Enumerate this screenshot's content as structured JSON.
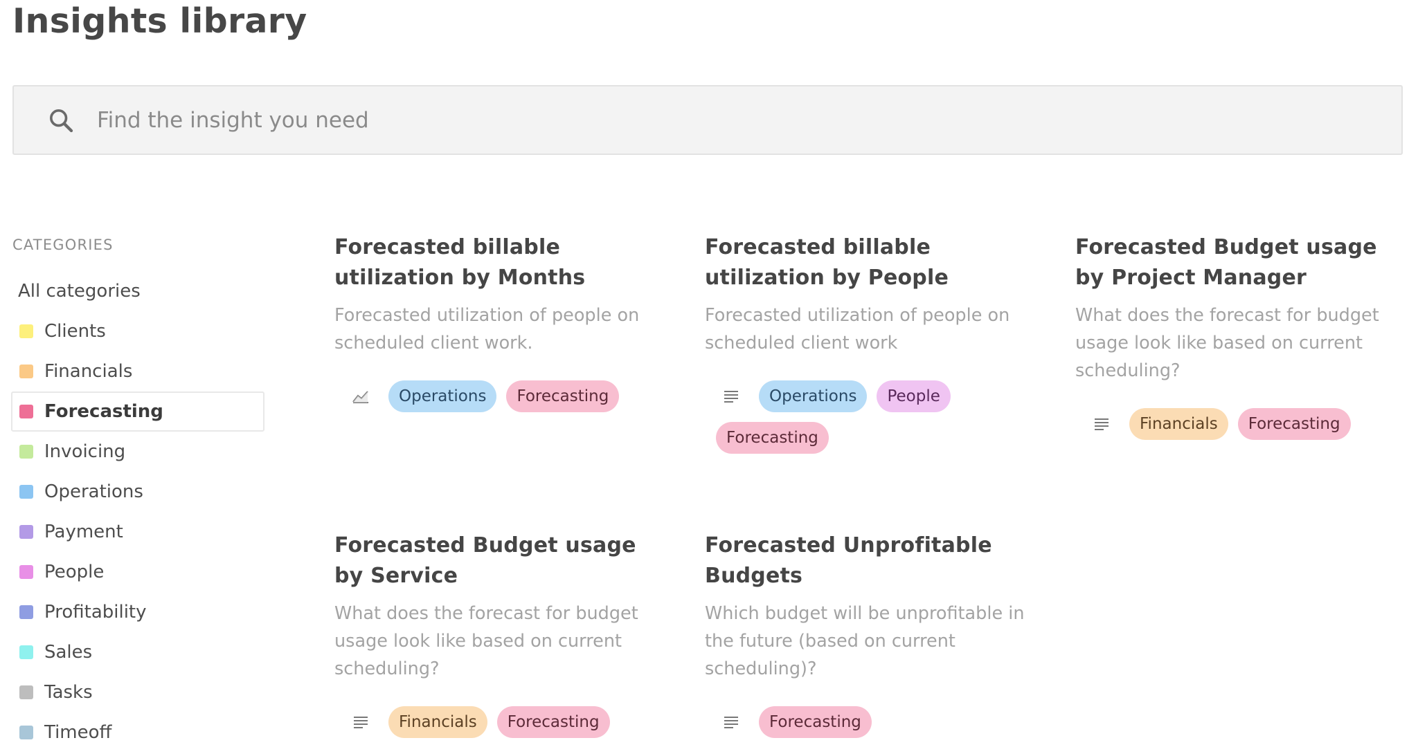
{
  "page": {
    "title": "Insights library"
  },
  "search": {
    "placeholder": "Find the insight you need"
  },
  "categories": {
    "header": "CATEGORIES",
    "items": [
      {
        "label": "All categories",
        "color": ""
      },
      {
        "label": "Clients",
        "color": "#fdf07c"
      },
      {
        "label": "Financials",
        "color": "#fbc986"
      },
      {
        "label": "Forecasting",
        "color": "#ee6f96"
      },
      {
        "label": "Invoicing",
        "color": "#c4ea9c"
      },
      {
        "label": "Operations",
        "color": "#8cc5f2"
      },
      {
        "label": "Payment",
        "color": "#b39ae6"
      },
      {
        "label": "People",
        "color": "#e88fe6"
      },
      {
        "label": "Profitability",
        "color": "#8f9de2"
      },
      {
        "label": "Sales",
        "color": "#8ff1ee"
      },
      {
        "label": "Tasks",
        "color": "#bdbdbd"
      },
      {
        "label": "Timeoff",
        "color": "#a8c6d8"
      }
    ],
    "active": "Forecasting"
  },
  "cards": [
    {
      "title": "Forecasted billable utilization by Months",
      "description": "Forecasted utilization of people on scheduled client work.",
      "icon": "chart-icon",
      "tags": [
        "Operations",
        "Forecasting"
      ]
    },
    {
      "title": "Forecasted billable utilization by People",
      "description": "Forecasted utilization of people on scheduled client work",
      "icon": "list-icon",
      "tags": [
        "Operations",
        "People",
        "Forecasting"
      ]
    },
    {
      "title": "Forecasted Budget usage by Project Manager",
      "description": "What does the forecast for budget usage look like based on current scheduling?",
      "icon": "list-icon",
      "tags": [
        "Financials",
        "Forecasting"
      ]
    },
    {
      "title": "Forecasted Budget usage by Service",
      "description": "What does the forecast for budget usage look like based on current scheduling?",
      "icon": "list-icon",
      "tags": [
        "Financials",
        "Forecasting"
      ]
    },
    {
      "title": "Forecasted Unprofitable Budgets",
      "description": "Which budget will be unprofitable in the future (based on current scheduling)?",
      "icon": "list-icon",
      "tags": [
        "Forecasting"
      ]
    }
  ]
}
